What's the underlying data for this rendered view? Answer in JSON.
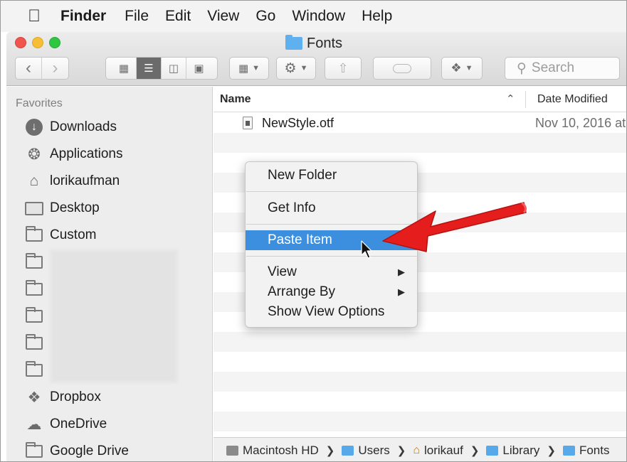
{
  "menubar": {
    "app": "Finder",
    "items": [
      "File",
      "Edit",
      "View",
      "Go",
      "Window",
      "Help"
    ]
  },
  "window": {
    "title": "Fonts",
    "search_placeholder": "Search"
  },
  "sidebar": {
    "heading": "Favorites",
    "items": [
      {
        "label": "Downloads",
        "icon": "download-icon"
      },
      {
        "label": "Applications",
        "icon": "applications-icon"
      },
      {
        "label": "lorikaufman",
        "icon": "home-icon"
      },
      {
        "label": "Desktop",
        "icon": "desktop-icon"
      },
      {
        "label": "Custom",
        "icon": "folder-icon"
      },
      {
        "label": "Dropbox",
        "icon": "dropbox-icon"
      },
      {
        "label": "OneDrive",
        "icon": "cloud-icon"
      },
      {
        "label": "Google Drive",
        "icon": "folder-icon"
      }
    ]
  },
  "list": {
    "col_name": "Name",
    "col_date": "Date Modified",
    "files": [
      {
        "name": "NewStyle.otf",
        "date": "Nov 10, 2016 at"
      }
    ]
  },
  "context_menu": {
    "new_folder": "New Folder",
    "get_info": "Get Info",
    "paste_item": "Paste Item",
    "view": "View",
    "arrange_by": "Arrange By",
    "show_view_options": "Show View Options"
  },
  "pathbar": {
    "segments": [
      "Macintosh HD",
      "Users",
      "lorikauf",
      "Library",
      "Fonts"
    ]
  },
  "colors": {
    "highlight": "#3c8fdf",
    "annotation_arrow": "#e51d1d",
    "folder_blue": "#5fb0ef"
  }
}
